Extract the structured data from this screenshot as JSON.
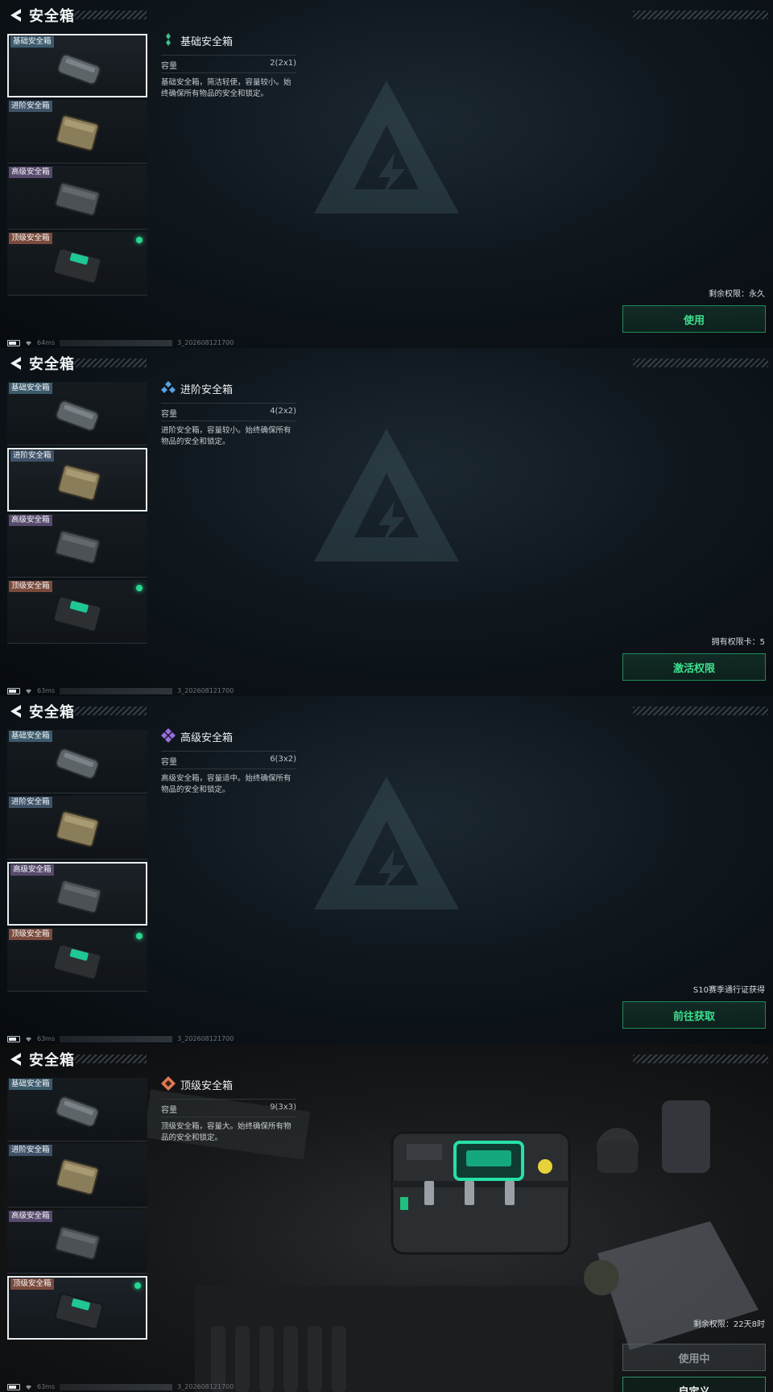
{
  "header": {
    "title": "安全箱"
  },
  "items": [
    {
      "label": "基础安全箱"
    },
    {
      "label": "进阶安全箱"
    },
    {
      "label": "高级安全箱"
    },
    {
      "label": "顶级安全箱"
    }
  ],
  "panels": [
    {
      "name": "基础安全箱",
      "capacity_label": "容量",
      "capacity_value": "2(2x1)",
      "description": "基础安全箱，简洁轻便，容量较小。始终确保所有物品的安全和锁定。",
      "status": "剩余权限：永久",
      "action": "使用",
      "ping": "64ms",
      "build": "3_202608121700"
    },
    {
      "name": "进阶安全箱",
      "capacity_label": "容量",
      "capacity_value": "4(2x2)",
      "description": "进阶安全箱，容量较小。始终确保所有物品的安全和锁定。",
      "status": "拥有权限卡：5",
      "action": "激活权限",
      "ping": "63ms",
      "build": "3_202608121700"
    },
    {
      "name": "高级安全箱",
      "capacity_label": "容量",
      "capacity_value": "6(3x2)",
      "description": "高级安全箱，容量适中。始终确保所有物品的安全和锁定。",
      "status": "S10赛季通行证获得",
      "action": "前往获取",
      "ping": "63ms",
      "build": "3_202608121700"
    },
    {
      "name": "顶级安全箱",
      "capacity_label": "容量",
      "capacity_value": "9(3x3)",
      "description": "顶级安全箱，容量大。始终确保所有物品的安全和锁定。",
      "status": "剩余权限：22天8时",
      "action": "使用中",
      "action_secondary": "自定义",
      "ping": "63ms",
      "build": "3_202608121700"
    }
  ],
  "colors": {
    "accent": "#3de08f",
    "owned_dot": "#26d88f",
    "tier_basic": "#3fbf8a",
    "tier_advanced": "#5aa0e0",
    "tier_high": "#9a6ee0",
    "tier_top": "#e07a50"
  }
}
